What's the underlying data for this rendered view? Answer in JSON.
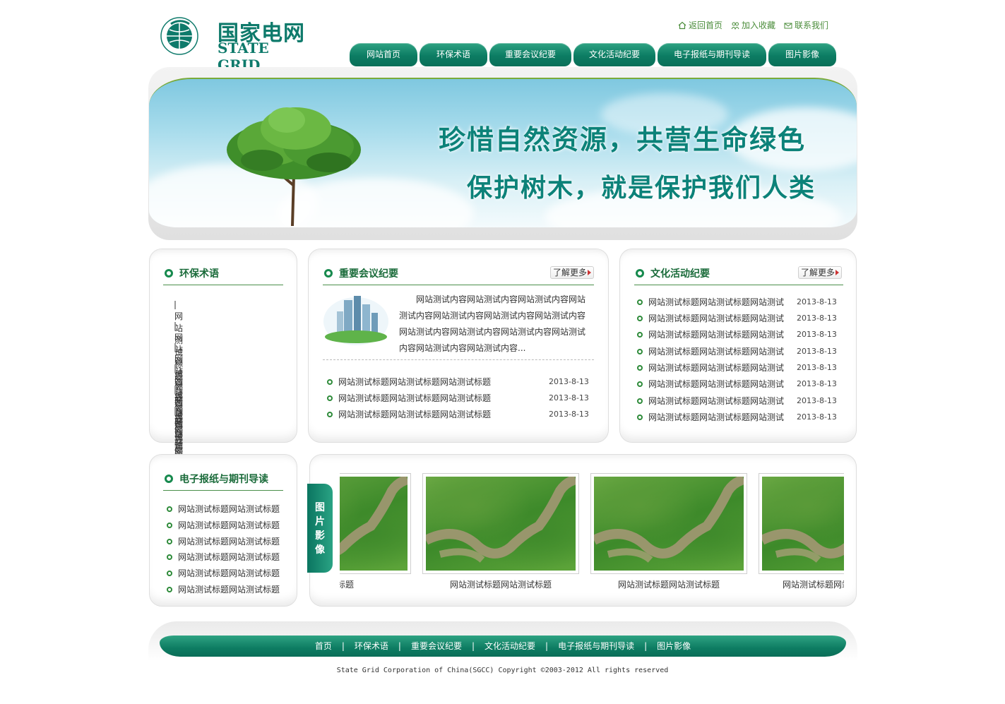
{
  "logo": {
    "cn": "国家电网",
    "en": "STATE GRID"
  },
  "toplinks": [
    {
      "label": "返回首页",
      "icon": "home-icon"
    },
    {
      "label": "加入收藏",
      "icon": "bookmark-icon"
    },
    {
      "label": "联系我们",
      "icon": "contact-icon"
    }
  ],
  "nav": [
    "网站首页",
    "环保术语",
    "重要会议纪要",
    "文化活动纪要",
    "电子报纸与期刊导读",
    "图片影像"
  ],
  "banner": {
    "line1": "珍惜自然资源，共营生命绿色",
    "line2": "保护树木，就是保护我们人类"
  },
  "env_terms": {
    "title": "环保术语",
    "items": [
      "网站测试标题网站测试",
      "网站测试标题网站测试",
      "网站测试标题网站测试",
      "网站测试标题网站测试",
      "网站测试标题网站测试",
      "网站测试标题网站测试"
    ]
  },
  "meetings": {
    "title": "重要会议纪要",
    "more": "了解更多",
    "summary": "网站测试内容网站测试内容网站测试内容网站测试内容网站测试内容网站测试内容网站测试内容网站测试内容网站测试内容网站测试内容网站测试内容网站测试内容网站测试内容...",
    "items": [
      {
        "title": "网站测试标题网站测试标题网站测试标题",
        "date": "2013-8-13"
      },
      {
        "title": "网站测试标题网站测试标题网站测试标题",
        "date": "2013-8-13"
      },
      {
        "title": "网站测试标题网站测试标题网站测试标题",
        "date": "2013-8-13"
      }
    ]
  },
  "culture": {
    "title": "文化活动纪要",
    "more": "了解更多",
    "items": [
      {
        "title": "网站测试标题网站测试标题网站测试",
        "date": "2013-8-13"
      },
      {
        "title": "网站测试标题网站测试标题网站测试",
        "date": "2013-8-13"
      },
      {
        "title": "网站测试标题网站测试标题网站测试",
        "date": "2013-8-13"
      },
      {
        "title": "网站测试标题网站测试标题网站测试",
        "date": "2013-8-13"
      },
      {
        "title": "网站测试标题网站测试标题网站测试",
        "date": "2013-8-13"
      },
      {
        "title": "网站测试标题网站测试标题网站测试",
        "date": "2013-8-13"
      },
      {
        "title": "网站测试标题网站测试标题网站测试",
        "date": "2013-8-13"
      },
      {
        "title": "网站测试标题网站测试标题网站测试",
        "date": "2013-8-13"
      }
    ]
  },
  "newspaper": {
    "title": "电子报纸与期刊导读",
    "items": [
      "网站测试标题网站测试标题",
      "网站测试标题网站测试标题",
      "网站测试标题网站测试标题",
      "网站测试标题网站测试标题",
      "网站测试标题网站测试标题",
      "网站测试标题网站测试标题"
    ]
  },
  "gallery": {
    "tab": "图片影像",
    "photos": [
      {
        "caption": "站测试标题"
      },
      {
        "caption": "网站测试标题网站测试标题"
      },
      {
        "caption": "网站测试标题网站测试标题"
      },
      {
        "caption": "网站测试标题网站"
      }
    ]
  },
  "footer": {
    "links": [
      "首页",
      "环保术语",
      "重要会议纪要",
      "文化活动纪要",
      "电子报纸与期刊导读",
      "图片影像"
    ],
    "copyright": "State Grid Corporation of China(SGCC)  Copyright ©2003-2012 All rights reserved"
  },
  "colors": {
    "brand": "#0e7a6b",
    "nav": "#0c7c63",
    "link": "#4b8d3b"
  }
}
